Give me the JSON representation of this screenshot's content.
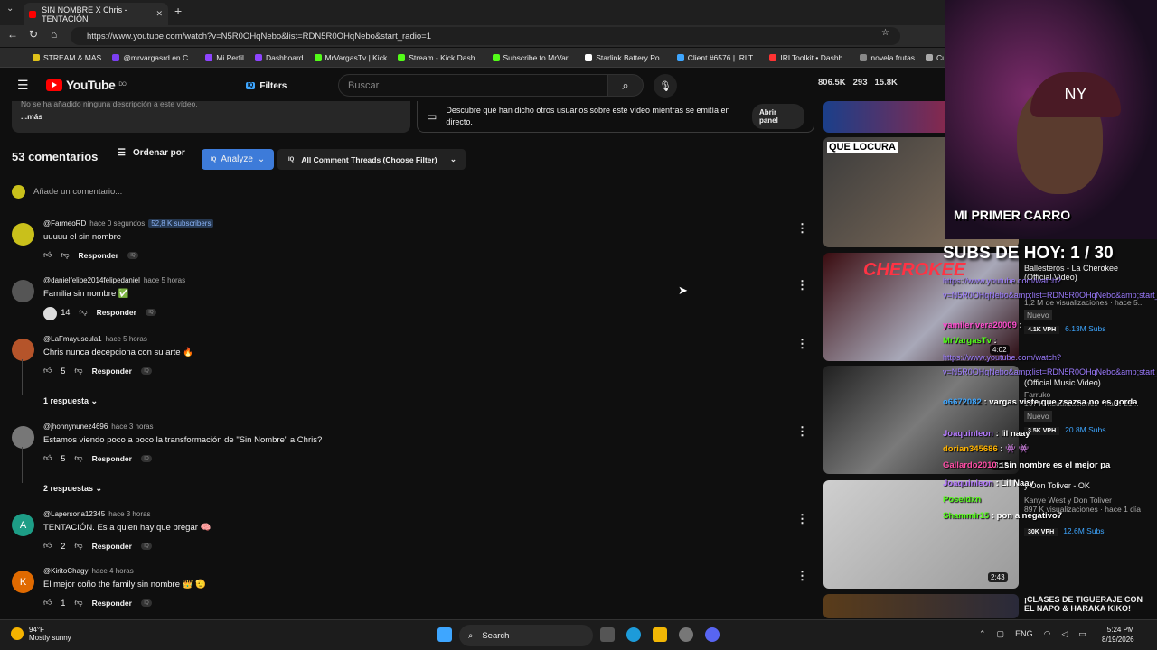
{
  "browser": {
    "tab_title": "SIN NOMBRE X Chris - TENTACIÓN",
    "url": "https://www.youtube.com/watch?v=N5R0OHqNebo&list=RDN5R0OHqNebo&start_radio=1",
    "bookmarks": [
      "STREAM & MAS",
      "@mrvargasrd en C...",
      "Mi Perfil",
      "Dashboard",
      "MrVargasTv | Kick",
      "Stream - Kick Dash...",
      "Subscribe to MrVar...",
      "Starlink Battery Po...",
      "Client #6576 | IRLT...",
      "IRLToolkit • Dashb...",
      "novela frutas",
      "Cu"
    ]
  },
  "yt": {
    "logo": "YouTube",
    "country": "DO",
    "filters": "Filters",
    "search_placeholder": "Buscar",
    "stats": [
      "806.5K",
      "293",
      "15.8K"
    ],
    "desc_text": "No se ha añadido ninguna descripción a este vídeo.",
    "desc_more": "...más",
    "chat_prompt": "Descubre qué han dicho otros usuarios sobre este vídeo mientras se emitía en directo.",
    "chat_button": "Abrir panel",
    "comment_count": "53 comentarios",
    "sort": "Ordenar por",
    "analyze": "Analyze",
    "threads": "All Comment Threads (Choose Filter)",
    "add_comment": "Añade un comentario...",
    "reply": "Responder"
  },
  "comments": [
    {
      "user": "@FarmeoRD",
      "time": "hace 0 segundos",
      "badge": "52,8 K subscribers",
      "text": "uuuuu el sin nombre",
      "likes": "",
      "avatar_color": "#c9c01b",
      "initial": ""
    },
    {
      "user": "@danielfelipe2014felipedaniel",
      "time": "hace 5 horas",
      "badge": "",
      "text": "Familia sin nombre ✅",
      "likes": "14",
      "avatar_color": "#555",
      "initial": ""
    },
    {
      "user": "@LaFmayuscula1",
      "time": "hace 5 horas",
      "badge": "",
      "text": "Chris nunca decepciona con su arte 🔥",
      "likes": "5",
      "avatar_color": "#b5542a",
      "initial": ""
    },
    {
      "user": "@jhonnynunez4696",
      "time": "hace 3 horas",
      "badge": "",
      "text": "Estamos viendo poco a poco la transformación de \"Sin Nombre\" a Chris?",
      "likes": "5",
      "avatar_color": "#777",
      "initial": ""
    },
    {
      "user": "@Lapersona12345",
      "time": "hace 3 horas",
      "badge": "",
      "text": "TENTACIÓN. Es a quien hay que bregar 🧠",
      "likes": "2",
      "avatar_color": "#1d9d86",
      "initial": "A"
    },
    {
      "user": "@KiritoChagy",
      "time": "hace 4 horas",
      "badge": "",
      "text": "El mejor coño the family sin nombre 👑 🫡",
      "likes": "1",
      "avatar_color": "#e06a00",
      "initial": "K"
    }
  ],
  "replies": [
    "1 respuesta",
    "2 respuestas"
  ],
  "sidebar": [
    {
      "title": "Ballesteros - La Cherokee",
      "channel": "(Official Video)",
      "views": "1,2 M de visualizaciones · hace 5...",
      "badge": "Nuevo",
      "vph": "4.1K VPH",
      "subs": "6.13M Subs",
      "duration": "4:02"
    },
    {
      "title": "(Official Music Video)",
      "channel": "Farruko",
      "views": "107 K visualizaciones · hace 21...",
      "badge": "Nuevo",
      "vph": "3.5K VPH",
      "subs": "20.8M Subs",
      "duration": "3:15"
    },
    {
      "title": "y Don Toliver - OK",
      "channel": "Kanye West y Don Toliver",
      "views": "897 K visualizaciones · hace 1 día",
      "badge": "",
      "vph": "30K VPH",
      "subs": "12.6M Subs",
      "duration": "2:43"
    },
    {
      "title": "¡CLASES DE TIGUERAJE CON EL NAPO & HARAKA KIKO!",
      "channel": "",
      "views": "",
      "badge": "",
      "vph": "",
      "subs": "",
      "duration": ""
    }
  ],
  "stream": {
    "cam_sign": "MI PRIMER CARRO",
    "subs_today": "SUBS DE HOY: 1 / 30",
    "chat": [
      {
        "name": "",
        "msg": "https://www.youtube.com/watch?v=N5R0OHqNebo&amp;list=RDN5R0OHqNebo&amp;start_radio=1",
        "color": "#9d7cff"
      },
      {
        "name": "yamilerivera20009",
        "msg": ":",
        "color": "#ff4dcf"
      },
      {
        "name": "MrVargasTv",
        "msg": ":",
        "color": "#53fc18"
      },
      {
        "name": "",
        "msg": "https://www.youtube.com/watch?v=N5R0OHqNebo&amp;list=RDN5R0OHqNebo&amp;start_radio=1",
        "color": "#9d7cff"
      },
      {
        "name": "o6672082",
        "msg": ": vargas viste que zsazsa no es gorda",
        "color": "#3ea6ff"
      },
      {
        "name": "Joaquinleon",
        "msg": ": lil naay",
        "color": "#b67cff"
      },
      {
        "name": "dorian345686",
        "msg": ": 👾 👾",
        "color": "#ffb300"
      },
      {
        "name": "Gallardo2010",
        "msg": ": sin nombre es el mejor pa",
        "color": "#ff4da6"
      },
      {
        "name": "Joaquinleon",
        "msg": ": Lil Naay",
        "color": "#b67cff"
      },
      {
        "name": "Poseidxn",
        "msg": "",
        "color": "#53fc18"
      },
      {
        "name": "Shammir15",
        "msg": ": pon a negativo7",
        "color": "#53fc18"
      }
    ]
  },
  "taskbar": {
    "temp": "94°F",
    "weather": "Mostly sunny",
    "search": "Search",
    "lang": "ENG",
    "time": "5:24 PM",
    "date": "8/19/2026"
  }
}
